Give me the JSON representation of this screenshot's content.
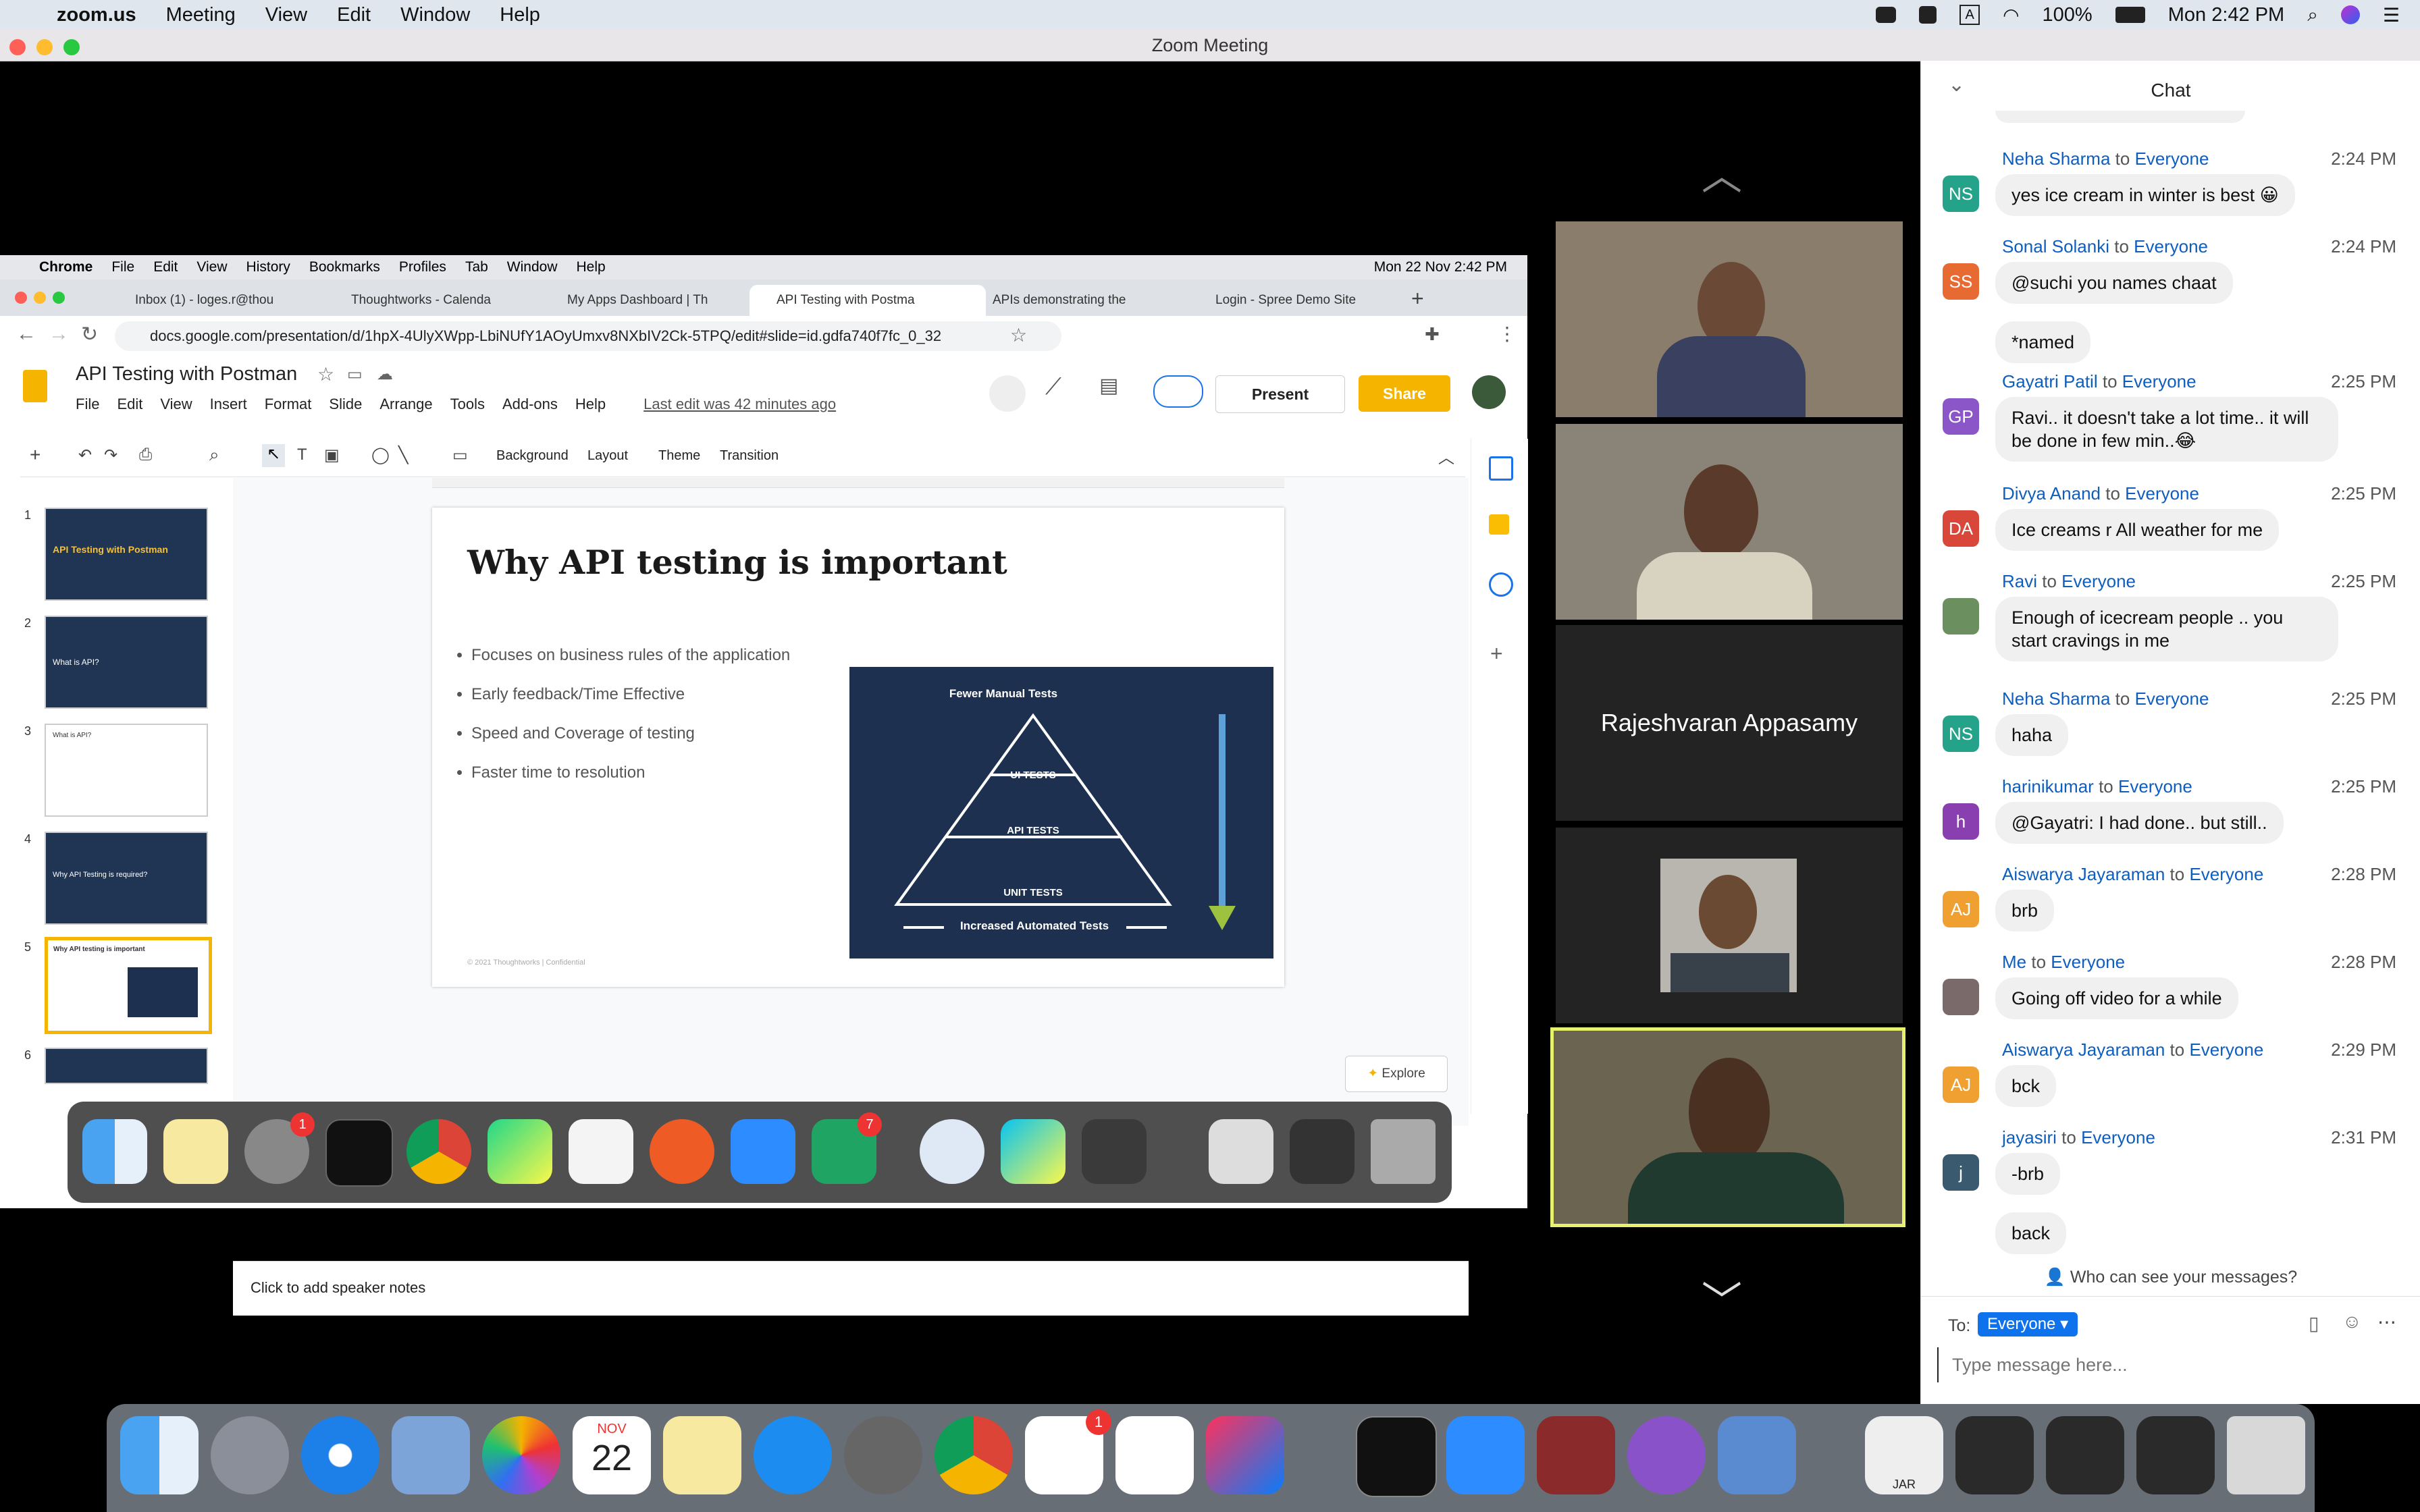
{
  "menubar": {
    "app": "zoom.us",
    "items": [
      "Meeting",
      "View",
      "Edit",
      "Window",
      "Help"
    ],
    "battery": "100%",
    "clock": "Mon 2:42 PM"
  },
  "zoom": {
    "title": "Zoom Meeting"
  },
  "share": {
    "chrome_menu": [
      "Chrome",
      "File",
      "Edit",
      "View",
      "History",
      "Bookmarks",
      "Profiles",
      "Tab",
      "Window",
      "Help"
    ],
    "chrome_clock": "Mon 22 Nov  2:42 PM",
    "tabs": [
      "Inbox (1) - loges.r@thou",
      "Thoughtworks - Calenda",
      "My Apps Dashboard | Th",
      "API Testing with Postma",
      "APIs demonstrating the",
      "Login - Spree Demo Site"
    ],
    "url": "docs.google.com/presentation/d/1hpX-4UlyXWpp-LbiNUfY1AOyUmxv8NXbIV2Ck-5TPQ/edit#slide=id.gdfa740f7fc_0_32",
    "doc_title": "API Testing with Postman",
    "doc_menu": [
      "File",
      "Edit",
      "View",
      "Insert",
      "Format",
      "Slide",
      "Arrange",
      "Tools",
      "Add-ons",
      "Help"
    ],
    "last_edit": "Last edit was 42 minutes ago",
    "present_label": "Present",
    "share_label": "Share",
    "toolbar": {
      "background": "Background",
      "layout": "Layout",
      "theme": "Theme",
      "transition": "Transition"
    },
    "thumbs": [
      {
        "num": "1",
        "text": "API Testing with Postman"
      },
      {
        "num": "2",
        "text": "What is API?"
      },
      {
        "num": "3",
        "text": "What is API?"
      },
      {
        "num": "4",
        "text": "Why API Testing is required?"
      },
      {
        "num": "5",
        "text": "Why API testing is important"
      },
      {
        "num": "6",
        "text": ""
      }
    ],
    "slide": {
      "title": "Why API testing is important",
      "bullets": [
        "Focuses on business rules of the application",
        "Early feedback/Time Effective",
        "Speed and Coverage of testing",
        "Faster time to resolution"
      ],
      "pyramid_top": "Fewer Manual Tests",
      "pyramid_levels": [
        "UI TESTS",
        "API TESTS",
        "UNIT TESTS"
      ],
      "pyramid_bottom": "Increased Automated Tests",
      "footer": "© 2021 Thoughtworks  |  Confidential"
    },
    "notes": "Click to add speaker notes",
    "explore": "Explore",
    "dock_badges": [
      "1",
      "7"
    ]
  },
  "participants": {
    "name_tile": "Rajeshvaran Appasamy"
  },
  "chat": {
    "title": "Chat",
    "messages": [
      {
        "initials": "NS",
        "color": "#25a38a",
        "sender": "Neha Sharma",
        "to": "to",
        "recipient": "Everyone",
        "time": "2:24 PM",
        "lines": [
          "yes ice cream in winter is best 😀"
        ]
      },
      {
        "initials": "SS",
        "color": "#e86a33",
        "sender": "Sonal Solanki",
        "to": "to",
        "recipient": "Everyone",
        "time": "2:24 PM",
        "lines": [
          "@suchi you names chaat",
          "*named"
        ]
      },
      {
        "initials": "GP",
        "color": "#8a56c8",
        "sender": "Gayatri Patil",
        "to": "to",
        "recipient": "Everyone",
        "time": "2:25 PM",
        "lines": [
          "Ravi.. it doesn't take a lot time.. it will be done in few min..😂"
        ]
      },
      {
        "initials": "DA",
        "color": "#d9473b",
        "sender": "Divya Anand",
        "to": "to",
        "recipient": "Everyone",
        "time": "2:25 PM",
        "lines": [
          "Ice creams r All weather for me"
        ]
      },
      {
        "initials": "",
        "color": "#6b8f5e",
        "sender": "Ravi",
        "to": "to",
        "recipient": "Everyone",
        "time": "2:25 PM",
        "lines": [
          "Enough of icecream people .. you start cravings in me"
        ]
      },
      {
        "initials": "NS",
        "color": "#25a38a",
        "sender": "Neha Sharma",
        "to": "to",
        "recipient": "Everyone",
        "time": "2:25 PM",
        "lines": [
          "haha"
        ]
      },
      {
        "initials": "h",
        "color": "#8a3fb0",
        "sender": "harinikumar",
        "to": "to",
        "recipient": "Everyone",
        "time": "2:25 PM",
        "lines": [
          "@Gayatri: I had done.. but still.."
        ]
      },
      {
        "initials": "AJ",
        "color": "#f0a030",
        "sender": "Aiswarya Jayaraman",
        "to": "to",
        "recipient": "Everyone",
        "time": "2:28 PM",
        "lines": [
          "brb"
        ]
      },
      {
        "initials": "",
        "color": "#7a6a6a",
        "sender": "Me",
        "to": "to",
        "recipient": "Everyone",
        "time": "2:28 PM",
        "lines": [
          "Going off video for a while"
        ]
      },
      {
        "initials": "AJ",
        "color": "#f0a030",
        "sender": "Aiswarya Jayaraman",
        "to": "to",
        "recipient": "Everyone",
        "time": "2:29 PM",
        "lines": [
          "bck"
        ]
      },
      {
        "initials": "j",
        "color": "#3a5a70",
        "sender": "jayasiri",
        "to": "to",
        "recipient": "Everyone",
        "time": "2:31 PM",
        "lines": [
          "-brb",
          "back"
        ]
      }
    ],
    "who_can_see": "Who can see your messages?",
    "to_label": "To:",
    "to_value": "Everyone",
    "input_placeholder": "Type message here..."
  },
  "dock": {
    "calendar_month": "NOV",
    "calendar_day": "22",
    "jar_label": "JAR",
    "badge": "1"
  }
}
